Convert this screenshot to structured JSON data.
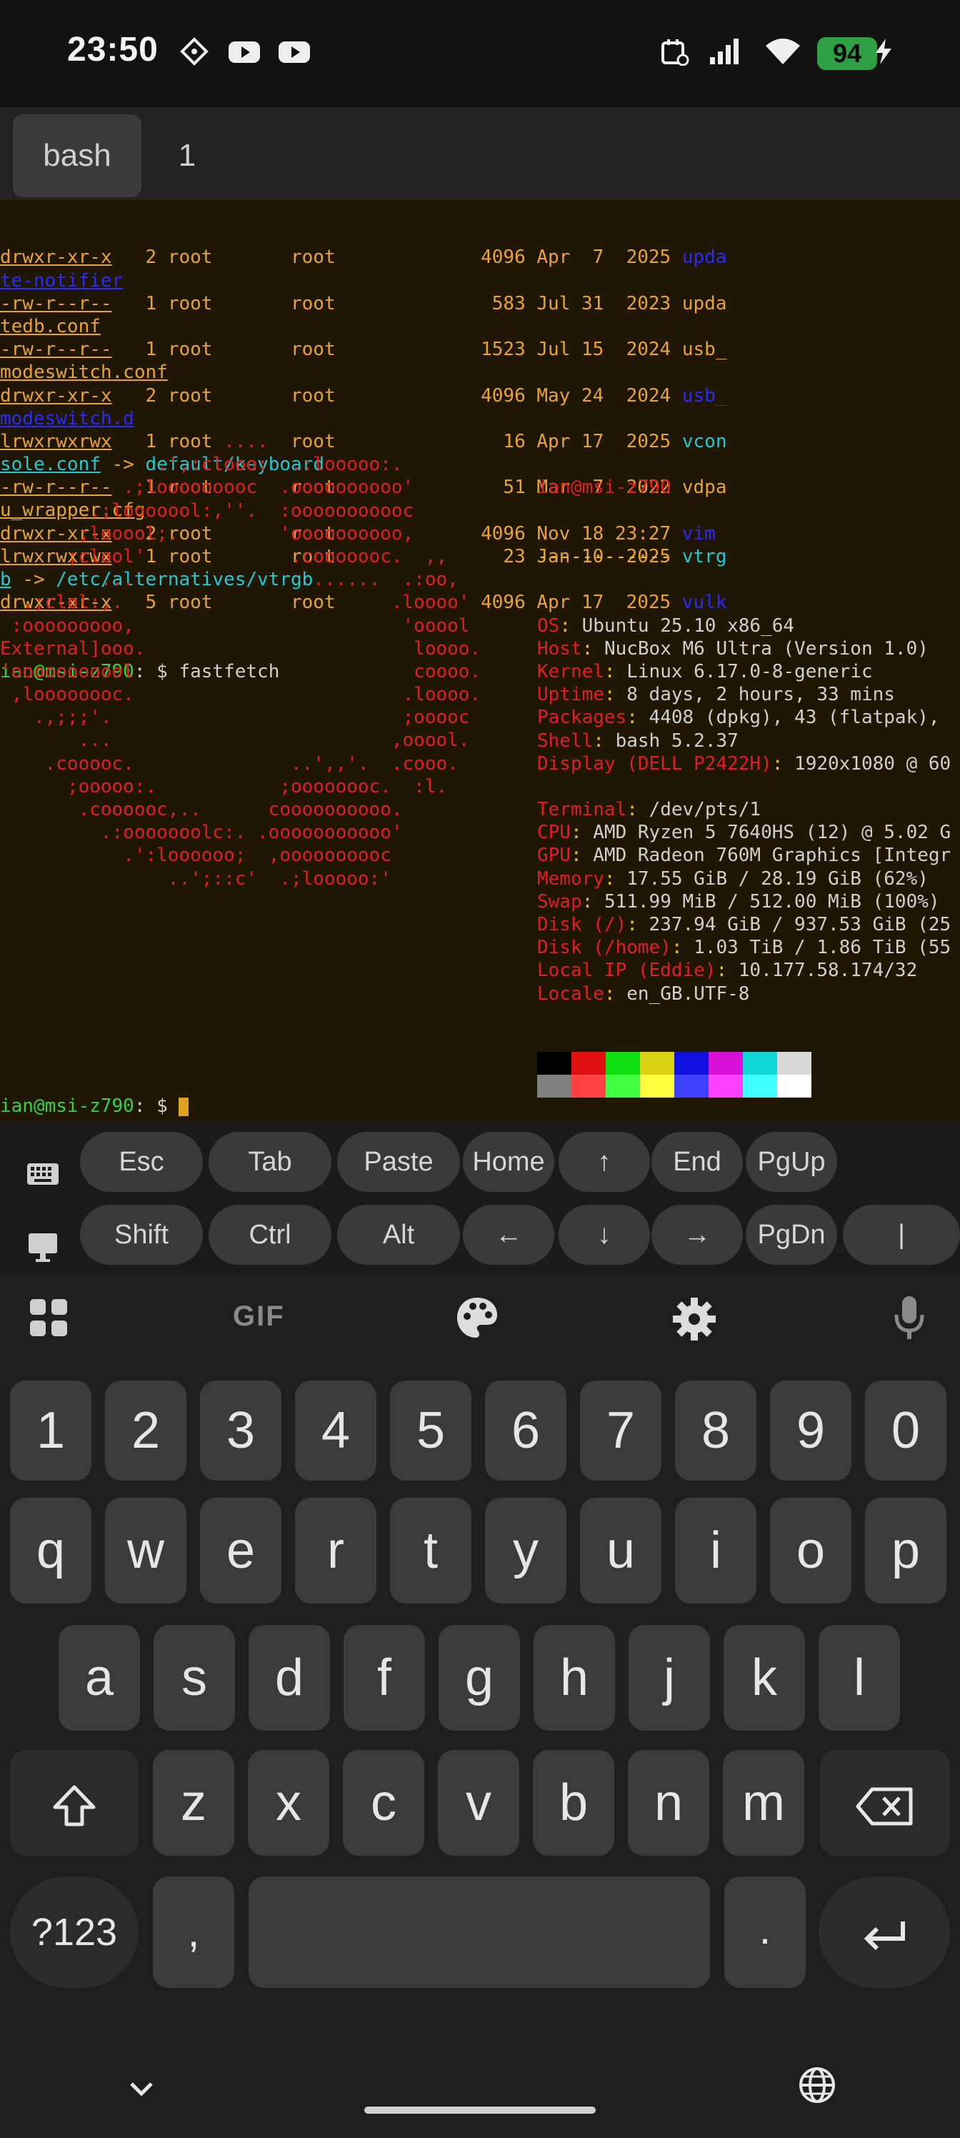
{
  "status_bar": {
    "time": "23:50",
    "battery": "94",
    "icons": [
      "tailscale-icon",
      "youtube-icon",
      "youtube-icon",
      "calendar-icon",
      "signal-icon",
      "wifi-icon",
      "charging-icon"
    ]
  },
  "tabs": [
    {
      "label": "bash"
    },
    {
      "label": "1"
    }
  ],
  "terminal": {
    "listing": [
      {
        "perm": "drwxr-xr-x",
        "links": "2",
        "user": "root",
        "group": "root",
        "size": "4096",
        "date": "Apr  7  2025",
        "name1": "upda",
        "name2": "te-notifier",
        "type": "dir"
      },
      {
        "perm": "-rw-r--r--",
        "links": "1",
        "user": "root",
        "group": "root",
        "size": "583",
        "date": "Jul 31  2023",
        "name1": "upda",
        "name2": "tedb.conf",
        "type": "file"
      },
      {
        "perm": "-rw-r--r--",
        "links": "1",
        "user": "root",
        "group": "root",
        "size": "1523",
        "date": "Jul 15  2024",
        "name1": "usb_",
        "name2": "modeswitch.conf",
        "type": "file"
      },
      {
        "perm": "drwxr-xr-x",
        "links": "2",
        "user": "root",
        "group": "root",
        "size": "4096",
        "date": "May 24  2024",
        "name1": "usb_",
        "name2": "modeswitch.d",
        "type": "dir"
      },
      {
        "perm": "lrwxrwxrwx",
        "links": "1",
        "user": "root",
        "group": "root",
        "size": "16",
        "date": "Apr 17  2025",
        "name1": "vcon",
        "name2": "sole.conf",
        "link": "default/keyboard",
        "type": "link"
      },
      {
        "perm": "-rw-r--r--",
        "links": "1",
        "user": "root",
        "group": "root",
        "size": "51",
        "date": "Mar  7  2022",
        "name1": "vdpa",
        "name2": "u_wrapper.cfg",
        "type": "file"
      },
      {
        "perm": "drwxr-xr-x",
        "links": "2",
        "user": "root",
        "group": "root",
        "size": "4096",
        "date": "Nov 18 23:27",
        "name1": "vim",
        "name2": "",
        "type": "dir"
      },
      {
        "perm": "lrwxrwxrwx",
        "links": "1",
        "user": "root",
        "group": "root",
        "size": "23",
        "date": "Jan 10  2025",
        "name1": "vtrg",
        "name2": "b",
        "link": "/etc/alternatives/vtrgb",
        "type": "link"
      },
      {
        "perm": "drwxr-xr-x",
        "links": "5",
        "user": "root",
        "group": "root",
        "size": "4096",
        "date": "Apr 17  2025",
        "name1": "vulk",
        "name2": "",
        "type": "dir"
      }
    ],
    "prompt": "ian@msi-z790",
    "prompt_suffix": ": $ ",
    "command": "fastfetch",
    "logo": [
      "                    ....",
      "              .',:clooo:  .:looooo:.",
      "           .;looooooooc  .oooooooooo'",
      "        .;looooool:,''.  :ooooooooooc",
      "       ;looool;.         'oooooooooo,",
      "      ;clool'             .cooooooc.  ,,",
      "         ...                ......  .:oo,",
      "  .;clol:,.                        .loooo'",
      " :ooooooooo,                        'ooool",
      "External]ooo.                        loooo.",
      "'ooooooooool                         coooo.",
      " ,loooooooc.                        .loooo.",
      "   .,;;;'.                          ;ooooc",
      "       ...                         ,ooool.",
      "    .cooooc.              ..',,'.  .cooo.",
      "      ;ooooo:.           ;oooooooc.  :l.",
      "       .coooooc,..      coooooooooo.",
      "         .:ooooooolc:. .ooooooooooo'",
      "           .':loooooo;  ,oooooooooc",
      "               ..';::c'  .;looooo:'"
    ],
    "info_title": "ian@msi-z790",
    "info_sep": "------------",
    "info": [
      {
        "k": "OS",
        "v": "Ubuntu 25.10 x86_64"
      },
      {
        "k": "Host",
        "v": "NucBox M6 Ultra (Version 1.0)"
      },
      {
        "k": "Kernel",
        "v": "Linux 6.17.0-8-generic"
      },
      {
        "k": "Uptime",
        "v": "8 days, 2 hours, 33 mins"
      },
      {
        "k": "Packages",
        "v": "4408 (dpkg), 43 (flatpak),"
      },
      {
        "k": "Shell",
        "v": "bash 5.2.37"
      },
      {
        "k": "Display (DELL P2422H)",
        "v": "1920x1080 @ 60"
      },
      {
        "k": "",
        "v": ""
      },
      {
        "k": "Terminal",
        "v": "/dev/pts/1"
      },
      {
        "k": "CPU",
        "v": "AMD Ryzen 5 7640HS (12) @ 5.02 G"
      },
      {
        "k": "GPU",
        "v": "AMD Radeon 760M Graphics [Integr"
      },
      {
        "k": "Memory",
        "v": "17.55 GiB / 28.19 GiB (62%)"
      },
      {
        "k": "Swap",
        "v": "511.99 MiB / 512.00 MiB (100%)"
      },
      {
        "k": "Disk (/)",
        "v": "237.94 GiB / 937.53 GiB (25"
      },
      {
        "k": "Disk (/home)",
        "v": "1.03 TiB / 1.86 TiB (55"
      },
      {
        "k": "Local IP (Eddie)",
        "v": "10.177.58.174/32"
      },
      {
        "k": "Locale",
        "v": "en_GB.UTF-8"
      }
    ],
    "colors_top": [
      "#000000",
      "#e01010",
      "#10e010",
      "#d8d010",
      "#1010e0",
      "#d810d8",
      "#10d8d8",
      "#d8d8d8"
    ],
    "colors_bottom": [
      "#808080",
      "#ff4040",
      "#40ff40",
      "#ffff40",
      "#4040ff",
      "#ff40ff",
      "#40ffff",
      "#ffffff"
    ]
  },
  "extra_keys": {
    "row1": [
      "Esc",
      "Tab",
      "Paste",
      "Home",
      "↑",
      "End",
      "PgUp"
    ],
    "row2": [
      "Shift",
      "Ctrl",
      "Alt",
      "←",
      "↓",
      "→",
      "PgDn",
      "|"
    ]
  },
  "keyboard": {
    "toolbar": [
      "apps-icon",
      "gif-icon",
      "palette-icon",
      "settings-icon",
      "mic-icon"
    ],
    "gif_label": "GIF",
    "numbers": [
      "1",
      "2",
      "3",
      "4",
      "5",
      "6",
      "7",
      "8",
      "9",
      "0"
    ],
    "row1": [
      "q",
      "w",
      "e",
      "r",
      "t",
      "y",
      "u",
      "i",
      "o",
      "p"
    ],
    "row2": [
      "a",
      "s",
      "d",
      "f",
      "g",
      "h",
      "j",
      "k",
      "l"
    ],
    "row3": [
      "z",
      "x",
      "c",
      "v",
      "b",
      "n",
      "m"
    ],
    "symbols_label": "?123",
    "comma": ",",
    "period": "."
  }
}
